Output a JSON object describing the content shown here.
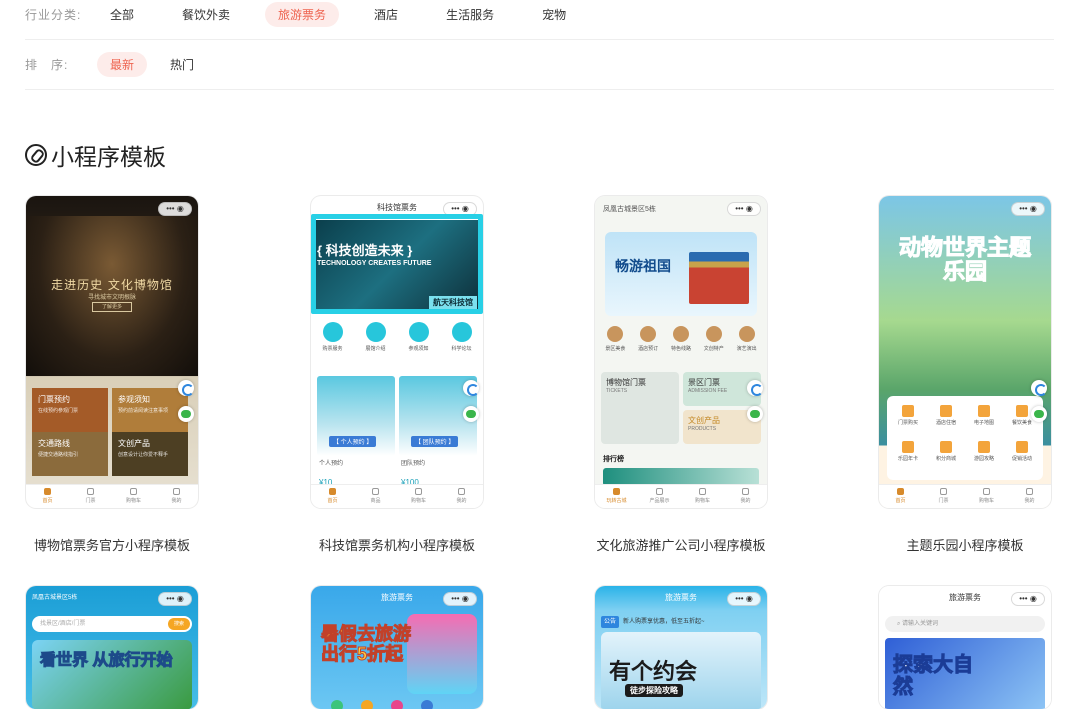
{
  "filters": {
    "industry_label": "行业分类:",
    "industry_options": [
      "全部",
      "餐饮外卖",
      "旅游票务",
      "酒店",
      "生活服务",
      "宠物"
    ],
    "industry_active": "旅游票务",
    "sort_label": "排　序:",
    "sort_options": [
      "最新",
      "热门"
    ],
    "sort_active": "最新"
  },
  "section": {
    "title": "小程序模板"
  },
  "cards": [
    {
      "caption": "博物馆票务官方小程序模板",
      "hero_title": "走进历史 文化博物馆",
      "hero_sub": "寻找城市文明根脉",
      "hero_btn": "了解更多",
      "tiles": [
        {
          "title": "门票预约",
          "sub": "在线预约参观门票"
        },
        {
          "title": "参观须知",
          "sub": "预约前请阅读注意事项"
        },
        {
          "title": "交通路线",
          "sub": "便捷交通路线指引"
        },
        {
          "title": "文创产品",
          "sub": "创意设计让你爱不释手"
        }
      ],
      "tabs": [
        "首页",
        "门票",
        "购物车",
        "我的"
      ]
    },
    {
      "caption": "科技馆票务机构小程序模板",
      "nav_title": "科技馆票务",
      "hero_title": "{ 科技创造未来 }",
      "hero_en": "TECHNOLOGY CREATES FUTURE",
      "brand": "航天科技馆",
      "icons": [
        "购票服务",
        "展馆介绍",
        "参观须知",
        "科学论坛"
      ],
      "products": [
        {
          "tag": "【 个人预约 】",
          "name": "个人预约",
          "price": "¥10"
        },
        {
          "tag": "【 团队预约 】",
          "name": "团队预约",
          "price": "¥100"
        }
      ],
      "tabs": [
        "首页",
        "商品",
        "购物车",
        "我的"
      ]
    },
    {
      "caption": "文化旅游推广公司小程序模板",
      "location": "凤凰古城景区5栋",
      "banner_title": "畅游祖国",
      "icons": [
        "景区美食",
        "酒店预订",
        "特色线路",
        "文创特产",
        "演艺演出"
      ],
      "box1": {
        "title": "博物馆门票",
        "sub": "TICKETS"
      },
      "box2": {
        "title": "景区门票",
        "sub": "ADMISSION FEE"
      },
      "box3": {
        "title": "文创产品",
        "sub": "PRODUCTS"
      },
      "rank": "排行榜",
      "tabs": [
        "玩转古城",
        "产品展示",
        "购物车",
        "我的"
      ]
    },
    {
      "caption": "主题乐园小程序模板",
      "hero_title": "动物世界主题乐园",
      "grid": [
        "门票购买",
        "酒店住宿",
        "电子地图",
        "餐饮美食",
        "乐园年卡",
        "积分商城",
        "游园攻略",
        "促销活动"
      ],
      "tabs": [
        "首页",
        "门票",
        "购物车",
        "我的"
      ]
    }
  ],
  "bottom_cards": [
    {
      "location": "凤凰古城景区5栋",
      "search": "找景区/酒店/门票",
      "search_btn": "搜索",
      "art": "看世界 从旅行开始"
    },
    {
      "nav_title": "旅游票务",
      "art": "暑假去旅游 出行5折起"
    },
    {
      "nav_title": "旅游票务",
      "notice_tag": "公告",
      "notice": "新人购票享优惠，低至五折起~",
      "art": "有个约会",
      "art_sub": "徒步探险攻略"
    },
    {
      "nav_title": "旅游票务",
      "search": "请输入关键词",
      "art": "探索大自然"
    }
  ],
  "colors": {
    "accent": "#ee6450",
    "active_bg": "#fdecea"
  }
}
